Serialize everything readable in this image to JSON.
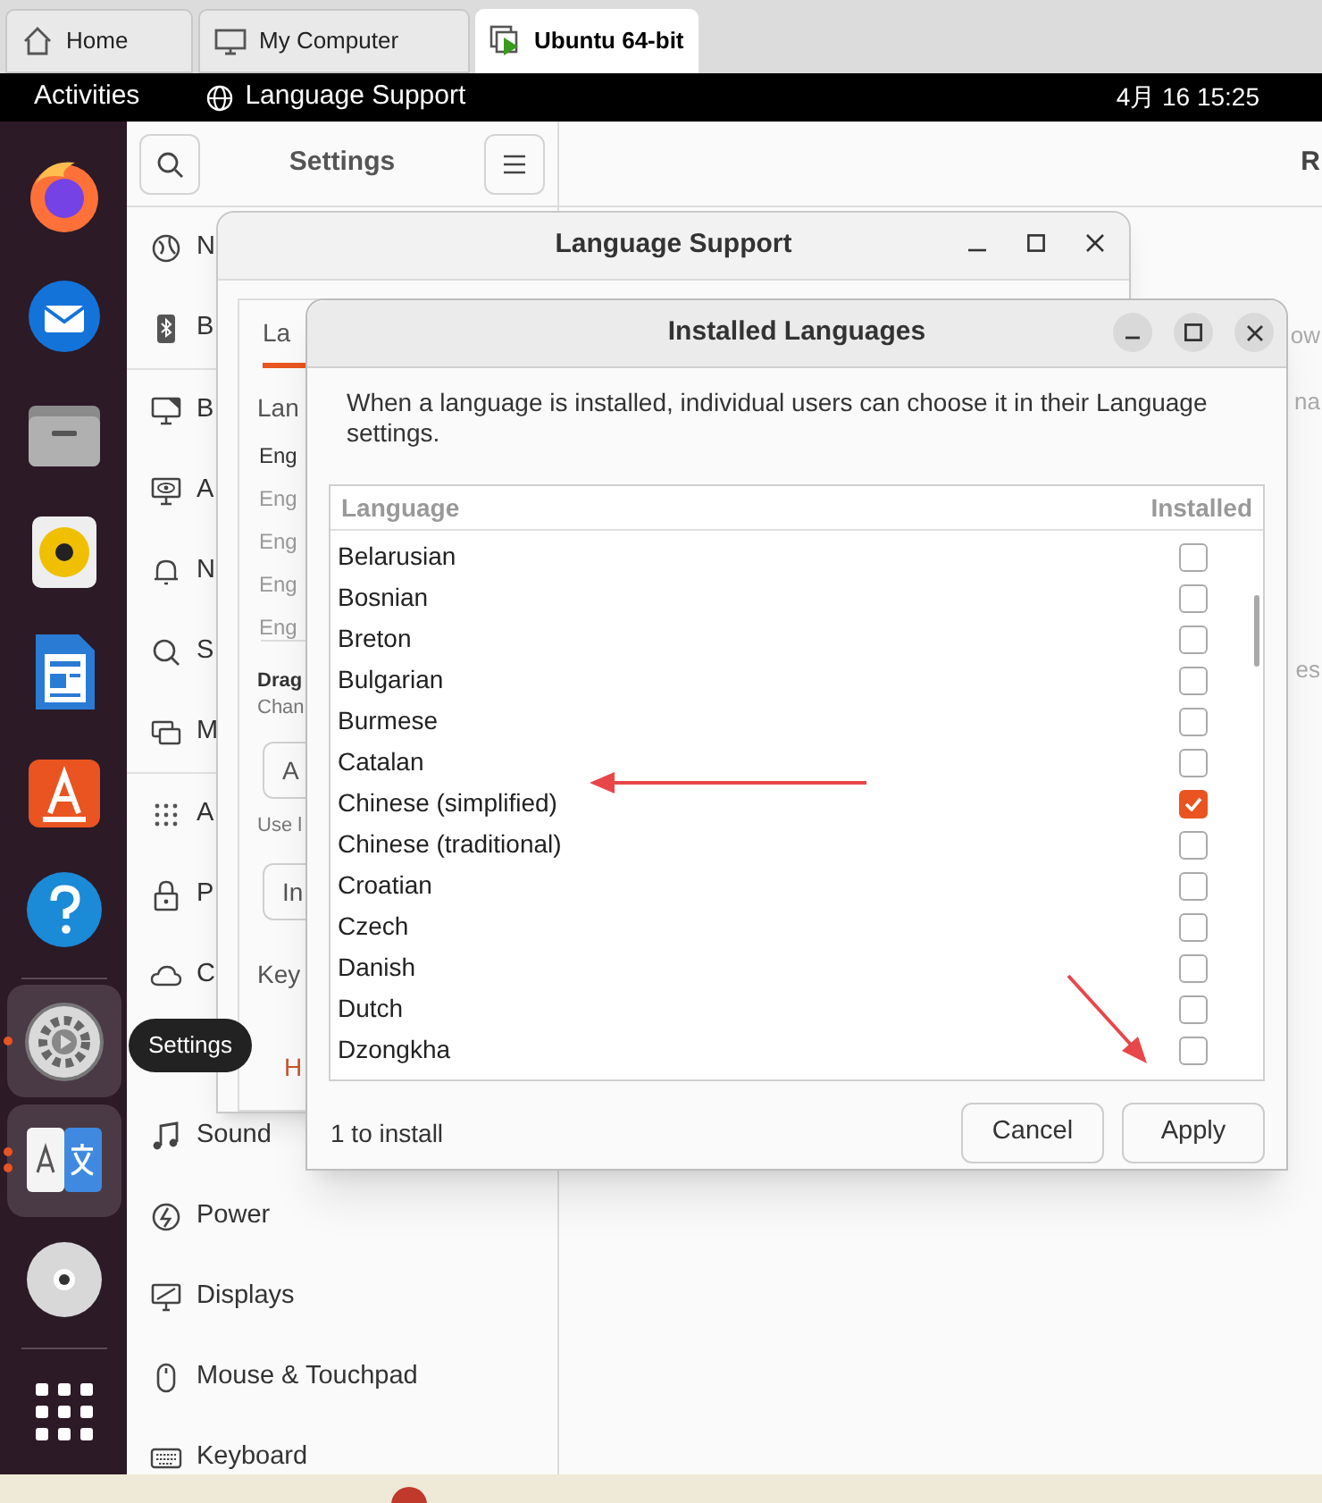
{
  "vm_tabs": [
    {
      "label": "Home",
      "selected": false
    },
    {
      "label": "My Computer",
      "selected": false
    },
    {
      "label": "Ubuntu 64-bit",
      "selected": true
    }
  ],
  "top_bar": {
    "activities": "Activities",
    "app": "Language Support",
    "clock": "4月 16 15:25"
  },
  "dock": [
    {
      "highlighted": false,
      "running": false,
      "multiple": false
    },
    {
      "highlighted": false,
      "running": false,
      "multiple": false
    },
    {
      "highlighted": false,
      "running": false,
      "multiple": false
    },
    {
      "highlighted": false,
      "running": false,
      "multiple": false
    },
    {
      "highlighted": false,
      "running": false,
      "multiple": false
    },
    {
      "highlighted": false,
      "running": false,
      "multiple": false
    },
    {
      "highlighted": false,
      "running": false,
      "multiple": false
    },
    {
      "highlighted": true,
      "running": true,
      "multiple": false
    },
    {
      "highlighted": true,
      "running": true,
      "multiple": true
    },
    {
      "highlighted": false,
      "running": false,
      "multiple": false
    },
    {
      "highlighted": false,
      "running": false,
      "multiple": false
    }
  ],
  "dock_tooltip": "Settings",
  "settings": {
    "title": "Settings",
    "panel_title": "R",
    "sidebar_top": [
      "N",
      "B",
      "B",
      "A",
      "N",
      "S",
      "M",
      "A",
      "P",
      "C"
    ],
    "sidebar_bottom": [
      "Sound",
      "Power",
      "Displays",
      "Mouse & Touchpad",
      "Keyboard"
    ],
    "panel_fragments": [
      "ow",
      "na",
      "es"
    ]
  },
  "language_support": {
    "title": "Language Support",
    "tab": "La",
    "heading": "Lan",
    "languages": [
      "Eng",
      "Eng",
      "Eng",
      "Eng",
      "Eng"
    ],
    "drag": "Drag",
    "drag_hint": "Chan",
    "button_1": "A",
    "hint": "Use l",
    "button_2": "In",
    "keyboard": "Key",
    "help": "H"
  },
  "installed_languages": {
    "title": "Installed Languages",
    "intro": "When a language is installed, individual users can choose it in their Language settings.",
    "columns": [
      "Language",
      "Installed"
    ],
    "rows": [
      {
        "name": "Belarusian",
        "checked": false
      },
      {
        "name": "Bosnian",
        "checked": false
      },
      {
        "name": "Breton",
        "checked": false
      },
      {
        "name": "Bulgarian",
        "checked": false
      },
      {
        "name": "Burmese",
        "checked": false
      },
      {
        "name": "Catalan",
        "checked": false
      },
      {
        "name": "Chinese (simplified)",
        "checked": true
      },
      {
        "name": "Chinese (traditional)",
        "checked": false
      },
      {
        "name": "Croatian",
        "checked": false
      },
      {
        "name": "Czech",
        "checked": false
      },
      {
        "name": "Danish",
        "checked": false
      },
      {
        "name": "Dutch",
        "checked": false
      },
      {
        "name": "Dzongkha",
        "checked": false
      }
    ],
    "status": "1 to install",
    "buttons": [
      "Cancel",
      "Apply"
    ]
  }
}
